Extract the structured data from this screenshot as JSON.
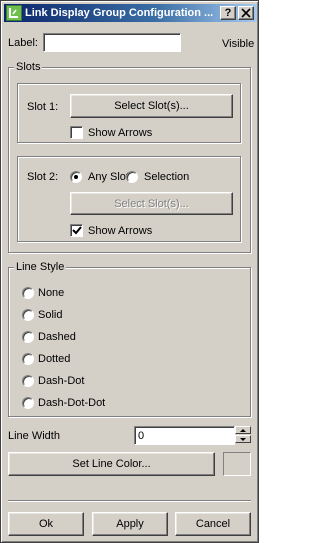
{
  "window": {
    "title": "Link Display Group Configuration ...",
    "help_label": "?",
    "close_label": "X"
  },
  "label_field": {
    "label": "Label:",
    "value": "",
    "visible_label": "Visible"
  },
  "slots": {
    "title": "Slots",
    "slot1": {
      "label": "Slot 1:",
      "select_button": "Select Slot(s)...",
      "show_arrows_label": "Show Arrows",
      "show_arrows_checked": false
    },
    "slot2": {
      "label": "Slot 2:",
      "any_slot_label": "Any Slot",
      "selection_label": "Selection",
      "selected_option": "Any Slot",
      "select_button": "Select Slot(s)...",
      "select_button_enabled": false,
      "show_arrows_label": "Show Arrows",
      "show_arrows_checked": true
    }
  },
  "line_style": {
    "title": "Line Style",
    "options": [
      "None",
      "Solid",
      "Dashed",
      "Dotted",
      "Dash-Dot",
      "Dash-Dot-Dot"
    ],
    "selected": null
  },
  "line_width": {
    "label": "Line Width",
    "value": "0"
  },
  "color": {
    "button_label": "Set Line Color...",
    "swatch_color": "#d4d0c8"
  },
  "footer": {
    "ok_label": "Ok",
    "apply_label": "Apply",
    "cancel_label": "Cancel"
  },
  "colors": {
    "face": "#d4d0c8",
    "title_start": "#0a246a",
    "title_end": "#a6caf0",
    "disabled_text": "#808080"
  }
}
